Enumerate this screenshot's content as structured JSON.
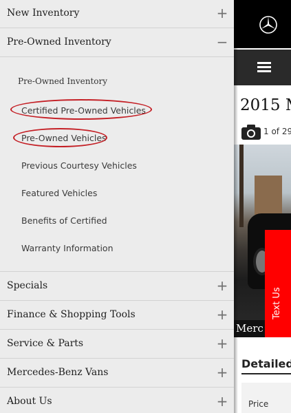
{
  "nav": {
    "new_inventory": "New Inventory",
    "pre_owned_inventory": "Pre-Owned Inventory",
    "submenu": {
      "heading": "Pre-Owned Inventory",
      "items": [
        "Certified Pre-Owned Vehicles",
        "Pre-Owned Vehicles",
        "Previous Courtesy Vehicles",
        "Featured Vehicles",
        "Benefits of Certified",
        "Warranty Information"
      ]
    },
    "specials": "Specials",
    "finance": "Finance & Shopping Tools",
    "service": "Service & Parts",
    "vans": "Mercedes-Benz Vans",
    "about": "About Us",
    "expand_symbol": "+",
    "collapse_symbol": "−"
  },
  "page": {
    "title": "2015 M",
    "photo_count": "1 of 29",
    "caption": "Merc",
    "text_us": "Text Us",
    "section": "Detailed",
    "price_label": "Price"
  },
  "colors": {
    "highlight_circle": "#c41f25",
    "text_us_bg": "#ff0000"
  }
}
